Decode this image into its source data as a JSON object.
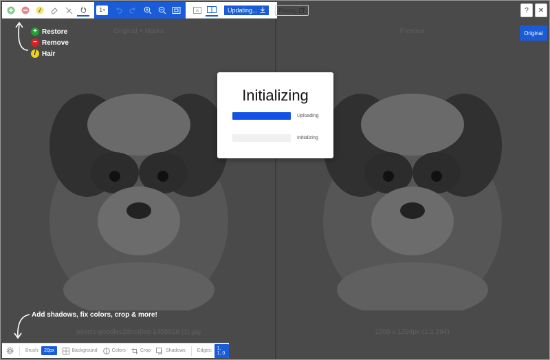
{
  "toolbar": {
    "select_value": "1",
    "updating_label": "Updating...",
    "pricing_label": "Pricing"
  },
  "corner": {
    "help_label": "?",
    "close_label": "✕",
    "original_label": "Original"
  },
  "panes": {
    "left_title": "Original + Marks",
    "right_title": "Preview",
    "left_caption": "pexels-poodles2doodles-1458916 (1).jpg",
    "right_caption": "1000 x 1294px (1:1.294)"
  },
  "legend": [
    {
      "label": "Restore",
      "symbol": "+",
      "color": "#1fa12f"
    },
    {
      "label": "Remove",
      "symbol": "−",
      "color": "#d62121"
    },
    {
      "label": "Hair",
      "symbol": "/",
      "color": "#f1d31c"
    }
  ],
  "note": "Add shadows, fix colors, crop & more!",
  "bottombar": {
    "brush_label": "Brush:",
    "brush_value": "20px",
    "background_label": "Background",
    "colors_label": "Colors",
    "crop_label": "Crop",
    "shadows_label": "Shadows",
    "edges_label": "Edges:",
    "edges_value": "1, 1, 0"
  },
  "modal": {
    "title": "Initializing",
    "progress": [
      {
        "label": "Uploading",
        "value": 1.0
      },
      {
        "label": "Initializing",
        "value": 0.0
      }
    ]
  },
  "colors": {
    "accent": "#1a5bd8",
    "workspace": "#4a4a4a"
  }
}
